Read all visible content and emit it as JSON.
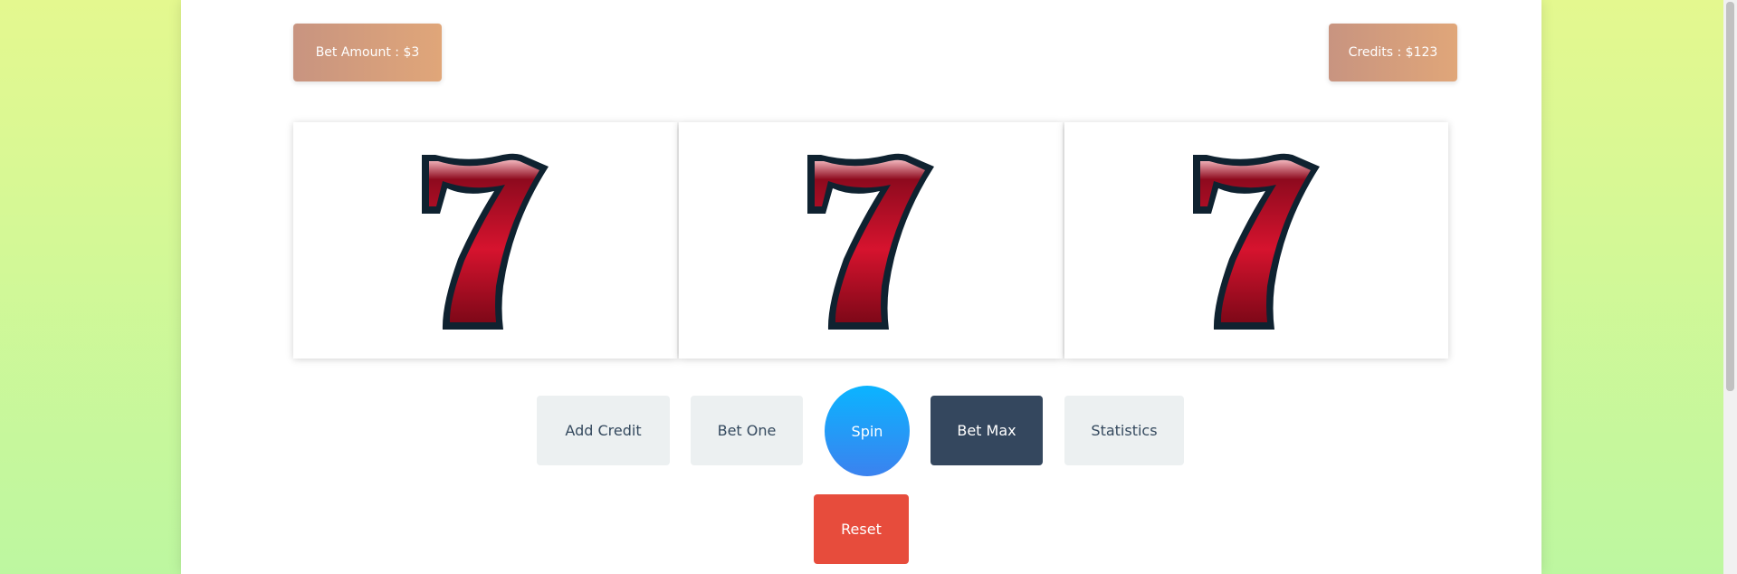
{
  "header": {
    "bet_amount": "Bet Amount : $3",
    "credits": "Credits : $123"
  },
  "reels": [
    {
      "symbol": "seven-icon"
    },
    {
      "symbol": "seven-icon"
    },
    {
      "symbol": "seven-icon"
    }
  ],
  "controls": {
    "add_credit": "Add Credit",
    "bet_one": "Bet One",
    "spin": "Spin",
    "bet_max": "Bet Max",
    "statistics": "Statistics",
    "reset": "Reset"
  },
  "colors": {
    "background_top": "#e4f88f",
    "background_bottom": "#bdf7a0",
    "badge_start": "#c89480",
    "badge_end": "#e0a679",
    "spin_start": "#0bb4ff",
    "spin_end": "#3b82ef",
    "bet_max": "#34475e",
    "reset": "#e74c3c",
    "seven_red": "#c8102e",
    "seven_outline": "#0f2230"
  }
}
